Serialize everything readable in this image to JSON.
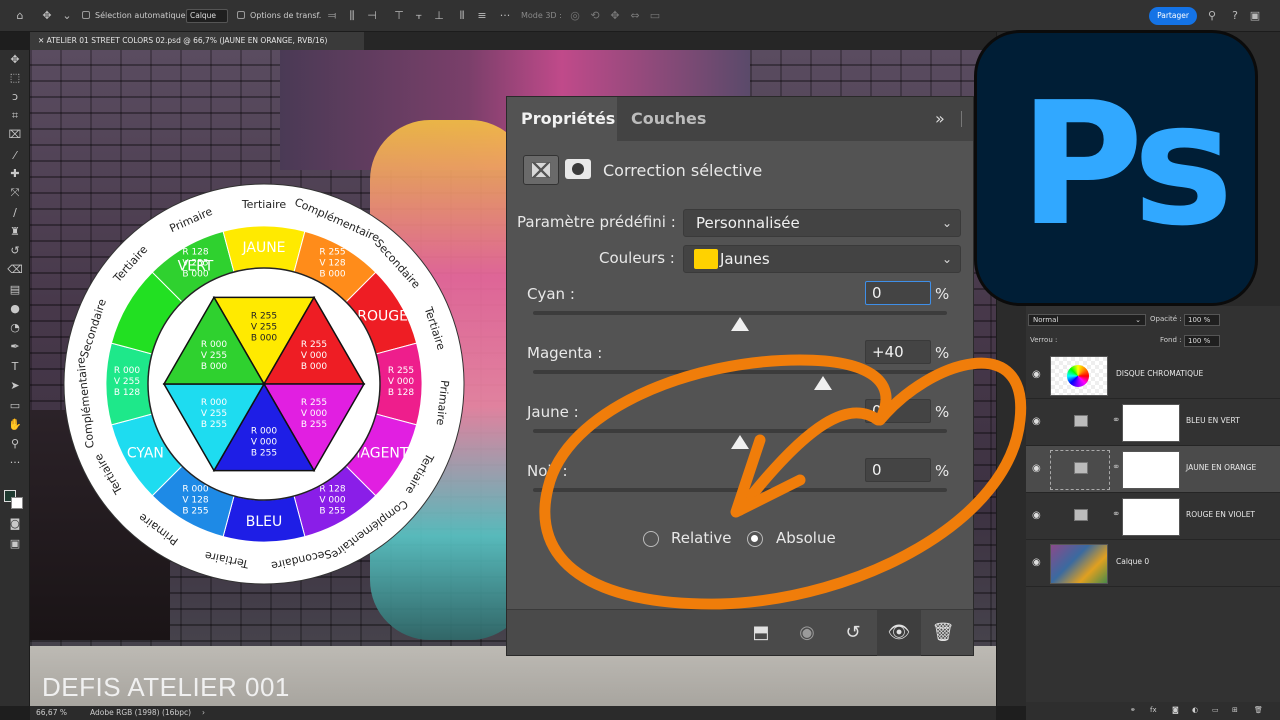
{
  "options_bar": {
    "auto_select_label": "Sélection automatique :",
    "layer_select_value": "Calque",
    "transform_options_label": "Options de transf.",
    "mode_3d_label": "Mode 3D :",
    "share_label": "Partager"
  },
  "document": {
    "tab_title": "ATELIER 01 STREET COLORS 02.psd @ 66,7% (JAUNE EN ORANGE, RVB/16)",
    "watermark": "DEFIS ATELIER 001"
  },
  "status_bar": {
    "zoom": "66,67 %",
    "profile": "Adobe RGB (1998) (16bpc)"
  },
  "color_wheel": {
    "outer_ring_labels": [
      "Tertiaire",
      "Complémentaire",
      "Secondaire",
      "Tertiaire",
      "Primaire",
      "Tertiaire",
      "Complémentaire",
      "Secondaire",
      "Tertiaire",
      "Primaire",
      "Tertiaire",
      "Complémentaire",
      "Secondaire",
      "Tertiaire",
      "Primaire"
    ],
    "segments": [
      {
        "name": "VERT",
        "rgb": [
          "R 128",
          "V 255",
          "B 000"
        ],
        "color": "#2fd12f"
      },
      {
        "name": "JAUNE",
        "rgb": [],
        "color": "#ffea00"
      },
      {
        "name": "",
        "rgb": [
          "R 255",
          "V 128",
          "B 000"
        ],
        "color": "#ff8c1a"
      },
      {
        "name": "ROUGE",
        "rgb": [],
        "color": "#ee1d24"
      },
      {
        "name": "",
        "rgb": [
          "R 255",
          "V 000",
          "B 128"
        ],
        "color": "#ee1e8c"
      },
      {
        "name": "MAGENTA",
        "rgb": [],
        "color": "#e11fe1"
      },
      {
        "name": "",
        "rgb": [
          "R 128",
          "V 000",
          "B 255"
        ],
        "color": "#8a1ee8"
      },
      {
        "name": "BLEU",
        "rgb": [],
        "color": "#1e1ee6"
      },
      {
        "name": "",
        "rgb": [
          "R 000",
          "V 128",
          "B 255"
        ],
        "color": "#1e8ae6"
      },
      {
        "name": "CYAN",
        "rgb": [],
        "color": "#1edcf0"
      },
      {
        "name": "",
        "rgb": [
          "R 000",
          "V 255",
          "B 128"
        ],
        "color": "#1ee88a"
      },
      {
        "name": "",
        "rgb": [],
        "color": "#22e022"
      }
    ],
    "inner": {
      "jaune": [
        "R 255",
        "V 255",
        "B 000"
      ],
      "vert": [
        "R 000",
        "V 255",
        "B 000"
      ],
      "cyan": [
        "R 000",
        "V 255",
        "B 255"
      ],
      "rouge": [
        "R 255",
        "V 000",
        "B 000"
      ],
      "bleu": [
        "R 000",
        "V 000",
        "B 255"
      ],
      "magenta": [
        "R 255",
        "V 000",
        "B 255"
      ]
    }
  },
  "properties": {
    "tab_active": "Propriétés",
    "tab_other": "Couches",
    "title": "Correction sélective",
    "preset_label": "Paramètre prédéfini :",
    "preset_value": "Personnalisée",
    "colors_label": "Couleurs :",
    "colors_value": "Jaunes",
    "colors_swatch": "#ffd200",
    "sliders": [
      {
        "label": "Cyan :",
        "value": "0",
        "position": 0.5
      },
      {
        "label": "Magenta :",
        "value": "+40",
        "position": 0.7
      },
      {
        "label": "Jaune :",
        "value": "0",
        "position": 0.5
      },
      {
        "label": "Noir :",
        "value": "0",
        "position": 0.5
      }
    ],
    "percent": "%",
    "radio_relative": "Relative",
    "radio_absolute": "Absolue",
    "selected_mode": "Absolue"
  },
  "layers": {
    "blend_mode": "Normal",
    "opacity_label": "Opacité :",
    "opacity_value": "100 %",
    "lock_label": "Verrou :",
    "fill_label": "Fond :",
    "fill_value": "100 %",
    "items": [
      {
        "name": "DISQUE CHROMATIQUE"
      },
      {
        "name": "BLEU EN VERT"
      },
      {
        "name": "JAUNE EN ORANGE"
      },
      {
        "name": "ROUGE EN VIOLET"
      },
      {
        "name": "Calque 0"
      }
    ]
  },
  "logo_text": "Ps",
  "accent_orange": "#f07d0a"
}
